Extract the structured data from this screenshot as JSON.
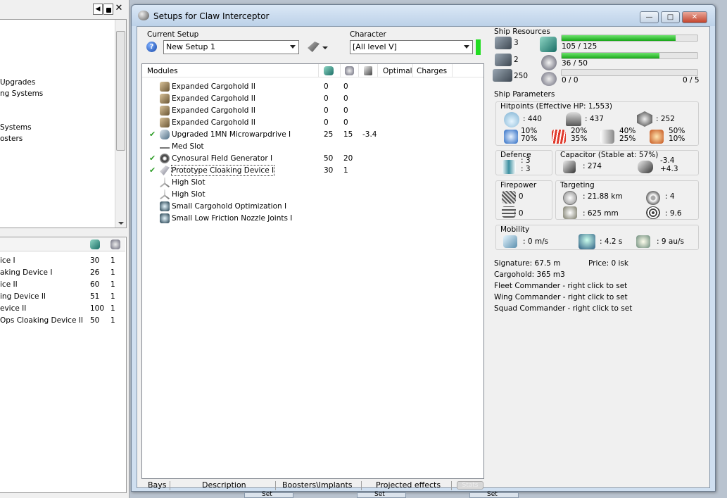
{
  "left_panel": {
    "toolbar": {
      "back": "◀",
      "lock": "🔒",
      "close": "✕"
    },
    "tree_items": [
      "Upgrades",
      "ng Systems",
      "Systems",
      "osters"
    ],
    "list": {
      "rows": [
        {
          "name": "ice I",
          "a": "30",
          "b": "1"
        },
        {
          "name": "aking Device I",
          "a": "26",
          "b": "1"
        },
        {
          "name": "ice II",
          "a": "60",
          "b": "1"
        },
        {
          "name": "ing Device II",
          "a": "51",
          "b": "1"
        },
        {
          "name": "evice II",
          "a": "100",
          "b": "1"
        },
        {
          "name": "Ops Cloaking Device II",
          "a": "50",
          "b": "1"
        }
      ]
    }
  },
  "window": {
    "title": "Setups for Claw Interceptor",
    "minimize": "—",
    "maximize": "□",
    "close": "✕"
  },
  "current_setup": {
    "label": "Current Setup",
    "help": "?",
    "value": "New Setup 1"
  },
  "character": {
    "label": "Character",
    "value": "[All level V]",
    "status_color": "#22dd22"
  },
  "modules": {
    "headers": {
      "name": "Modules",
      "optimal": "Optimal",
      "charges": "Charges"
    },
    "rows": [
      {
        "check": "",
        "icon": "cargohold-icon",
        "name": "Expanded Cargohold II",
        "cpu": "0",
        "pg": "0",
        "cap": "",
        "optimal": ""
      },
      {
        "check": "",
        "icon": "cargohold-icon",
        "name": "Expanded Cargohold II",
        "cpu": "0",
        "pg": "0",
        "cap": "",
        "optimal": ""
      },
      {
        "check": "",
        "icon": "cargohold-icon",
        "name": "Expanded Cargohold II",
        "cpu": "0",
        "pg": "0",
        "cap": "",
        "optimal": ""
      },
      {
        "check": "",
        "icon": "cargohold-icon",
        "name": "Expanded Cargohold II",
        "cpu": "0",
        "pg": "0",
        "cap": "",
        "optimal": ""
      },
      {
        "check": "✔",
        "icon": "microwarpdrive-icon",
        "name": "Upgraded 1MN Microwarpdrive I",
        "cpu": "25",
        "pg": "15",
        "cap": "-3.4",
        "optimal": ""
      },
      {
        "check": "",
        "icon": "med-slot-icon",
        "name": "Med Slot",
        "cpu": "",
        "pg": "",
        "cap": "",
        "optimal": ""
      },
      {
        "check": "✔",
        "icon": "cynosural-icon",
        "name": "Cynosural Field Generator I",
        "cpu": "50",
        "pg": "20",
        "cap": "",
        "optimal": ""
      },
      {
        "check": "✔",
        "icon": "cloaking-icon",
        "name": "Prototype Cloaking Device I",
        "cpu": "30",
        "pg": "1",
        "cap": "",
        "optimal": ""
      },
      {
        "check": "",
        "icon": "high-slot-icon",
        "name": "High Slot",
        "cpu": "",
        "pg": "",
        "cap": "",
        "optimal": ""
      },
      {
        "check": "",
        "icon": "high-slot-icon",
        "name": "High Slot",
        "cpu": "",
        "pg": "",
        "cap": "",
        "optimal": ""
      },
      {
        "check": "",
        "icon": "rig-icon",
        "name": "Small Cargohold Optimization I",
        "cpu": "",
        "pg": "",
        "cap": "",
        "optimal": ""
      },
      {
        "check": "",
        "icon": "rig-icon",
        "name": "Small Low Friction Nozzle Joints I",
        "cpu": "",
        "pg": "",
        "cap": "",
        "optimal": ""
      }
    ]
  },
  "tabs": [
    "Bays",
    "Description",
    "Boosters\\Implants",
    "Projected effects",
    "Stats"
  ],
  "ship_resources": {
    "label": "Ship Resources",
    "turrets": "3",
    "launchers": "2",
    "drone_bay": "250",
    "cpu": {
      "text": "105 / 125",
      "fill": 0.84
    },
    "powergrid": {
      "text": "36 / 50",
      "fill": 0.72
    },
    "drones": {
      "text": "0 / 0",
      "fill": 0
    },
    "calibration": {
      "text": "0 / 5",
      "fill": 0
    }
  },
  "ship_parameters": {
    "label": "Ship Parameters",
    "hitpoints": {
      "label": "Hitpoints (Effective HP: 1,553)",
      "shield": ": 440",
      "armor": ": 437",
      "structure": ": 252",
      "em": [
        "10%",
        "70%"
      ],
      "thermal": [
        "20%",
        "35%"
      ],
      "kinetic": [
        "40%",
        "25%"
      ],
      "explosive": [
        "50%",
        "10%"
      ]
    },
    "defence": {
      "label": "Defence",
      "a": ": 3",
      "b": ": 3"
    },
    "capacitor": {
      "label": "Capacitor (Stable at: 57%)",
      "capacity": ": 274",
      "use": "-3.4",
      "recharge": "+4.3"
    },
    "firepower": {
      "label": "Firepower",
      "dps": ": 0",
      "volley": ": 0"
    },
    "targeting": {
      "label": "Targeting",
      "range": ": 21.88 km",
      "targets": ": 4",
      "resolution": ": 625 mm",
      "sensor": ": 9.6"
    },
    "mobility": {
      "label": "Mobility",
      "speed": ": 0 m/s",
      "align": ": 4.2 s",
      "warp": ": 9 au/s"
    },
    "signature": "Signature: 67.5 m",
    "price": "Price: 0 isk",
    "cargohold": "Cargohold: 365 m3",
    "fleet": "Fleet Commander - right click to set",
    "wing": "Wing Commander - right click to set",
    "squad": "Squad Commander - right click to set"
  },
  "taskbar": {
    "item": "Set"
  }
}
